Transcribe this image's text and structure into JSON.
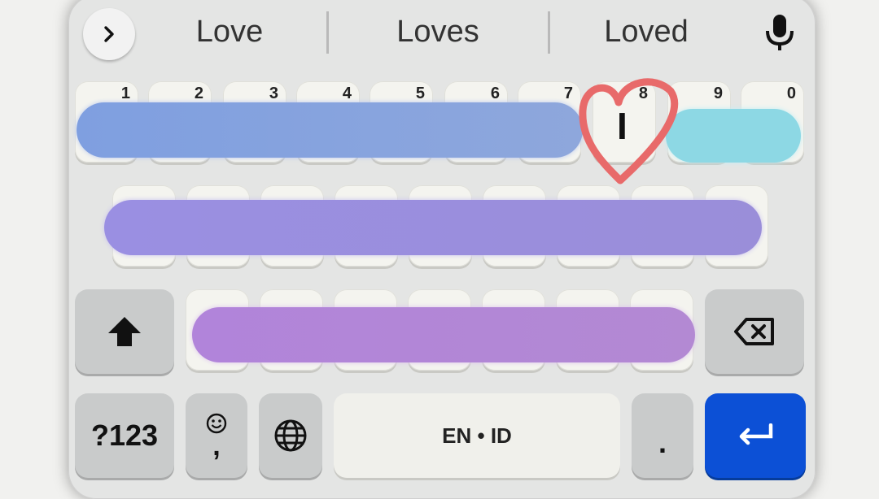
{
  "suggestions": {
    "items": [
      "Love",
      "Loves",
      "Loved"
    ],
    "expand_icon": "chevron-right-icon",
    "mic_icon": "microphone-icon"
  },
  "number_row": [
    "1",
    "2",
    "3",
    "4",
    "5",
    "6",
    "7",
    "8",
    "9",
    "0"
  ],
  "cursor_char": "I",
  "bottom_row": {
    "symbols_label": "?123",
    "emoji_icon": "smiley-icon",
    "comma_label": ",",
    "globe_icon": "globe-icon",
    "space_label": "EN • ID",
    "period_label": ".",
    "enter_icon": "enter-arrow-icon"
  },
  "function_keys": {
    "shift_icon": "shift-arrow-icon",
    "backspace_icon": "backspace-icon"
  },
  "colors": {
    "row1_pill": "#8aa3dd",
    "row1_accent_pill": "#8dd8e4",
    "row2_pill": "#9c8fdf",
    "row3_pill": "#b483d8",
    "heart": "#e86a6a",
    "enter": "#0c50d6"
  }
}
